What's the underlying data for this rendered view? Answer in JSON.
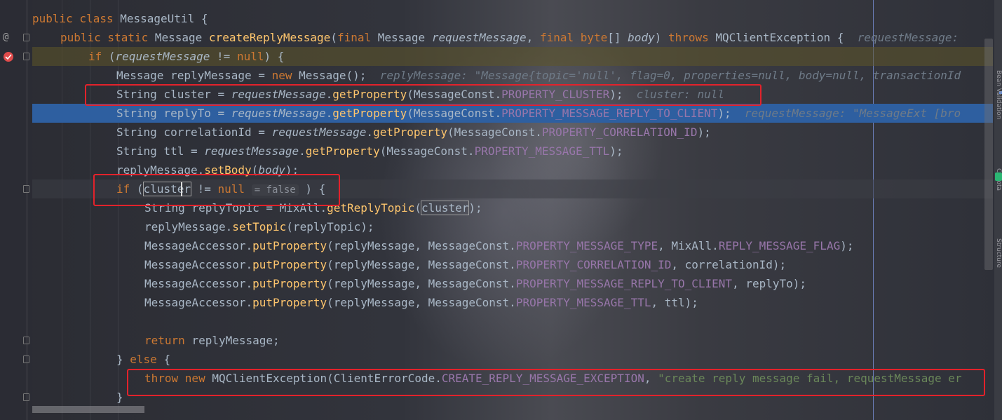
{
  "editor": {
    "file_class": "MessageUtil",
    "lines": [
      [
        [
          "public class ",
          "kw"
        ],
        [
          "MessageUtil ",
          ""
        ],
        [
          "{",
          ""
        ]
      ],
      [
        [
          "public static ",
          "kw"
        ],
        [
          "Message ",
          ""
        ],
        [
          "createReplyMessage",
          "fn"
        ],
        [
          "(",
          ""
        ],
        [
          "final ",
          "kw"
        ],
        [
          "Message ",
          ""
        ],
        [
          "requestMessage",
          "it"
        ],
        [
          ", ",
          ""
        ],
        [
          "final byte",
          "kw"
        ],
        [
          "[] ",
          ""
        ],
        [
          "body",
          "it"
        ],
        [
          ") ",
          ""
        ],
        [
          "throws ",
          "kw"
        ],
        [
          "MQClientException ",
          ""
        ],
        [
          "{ ",
          ""
        ],
        [
          " requestMessage: ",
          "inl"
        ]
      ],
      [
        [
          "if ",
          "kw"
        ],
        [
          "(",
          ""
        ],
        [
          "requestMessage",
          "it"
        ],
        [
          " != ",
          ""
        ],
        [
          "null",
          "kw"
        ],
        [
          ") {",
          ""
        ]
      ],
      [
        [
          "Message replyMessage = ",
          ""
        ],
        [
          "new ",
          "kw"
        ],
        [
          "Message",
          ""
        ],
        [
          "(",
          ""
        ],
        [
          ")",
          ""
        ],
        [
          "; ",
          ""
        ],
        [
          " replyMessage: \"Message{topic='null', flag=0, properties=null, body=null, transactionId",
          "inl"
        ]
      ],
      [
        [
          "String cluster = ",
          ""
        ],
        [
          "requestMessage",
          "it"
        ],
        [
          ".",
          ""
        ],
        [
          "getProperty",
          "fn"
        ],
        [
          "(MessageConst.",
          ""
        ],
        [
          "PROPERTY_CLUSTER",
          "cn"
        ],
        [
          ");",
          ""
        ],
        [
          "  cluster: null",
          "inl"
        ]
      ],
      [
        [
          "String replyTo = ",
          ""
        ],
        [
          "requestMessage",
          "it"
        ],
        [
          ".",
          ""
        ],
        [
          "getProperty",
          "fn"
        ],
        [
          "(MessageConst.",
          ""
        ],
        [
          "PROPERTY_MESSAGE_REPLY_TO_CLIENT",
          "cn"
        ],
        [
          ");",
          ""
        ],
        [
          "  requestMessage: \"MessageExt [bro",
          "inl"
        ]
      ],
      [
        [
          "String correlationId = ",
          ""
        ],
        [
          "requestMessage",
          "it"
        ],
        [
          ".",
          ""
        ],
        [
          "getProperty",
          "fn"
        ],
        [
          "(MessageConst.",
          ""
        ],
        [
          "PROPERTY_CORRELATION_ID",
          "cn"
        ],
        [
          ");",
          ""
        ]
      ],
      [
        [
          "String ttl = ",
          ""
        ],
        [
          "requestMessage",
          "it"
        ],
        [
          ".",
          ""
        ],
        [
          "getProperty",
          "fn"
        ],
        [
          "(MessageConst.",
          ""
        ],
        [
          "PROPERTY_MESSAGE_TTL",
          "cn"
        ],
        [
          ");",
          ""
        ]
      ],
      [
        [
          "replyMessage.",
          ""
        ],
        [
          "setBody",
          "fn"
        ],
        [
          "(",
          ""
        ],
        [
          "body",
          "it"
        ],
        [
          ");",
          ""
        ]
      ],
      [
        [
          "if ",
          "kw"
        ],
        [
          "(",
          ""
        ],
        [
          "cluster",
          "boxed"
        ],
        [
          " != ",
          ""
        ],
        [
          "null",
          "kw"
        ],
        [
          " ",
          ""
        ],
        [
          "= false",
          "inlhint"
        ],
        [
          " ) {",
          ""
        ]
      ],
      [
        [
          "String replyTopic = MixAll.",
          ""
        ],
        [
          "getReplyTopic",
          "fn"
        ],
        [
          "(",
          ""
        ],
        [
          "cluster",
          "boxed"
        ],
        [
          ");",
          ""
        ]
      ],
      [
        [
          "replyMessage.",
          ""
        ],
        [
          "setTopic",
          "fn"
        ],
        [
          "(replyTopic);",
          ""
        ]
      ],
      [
        [
          "MessageAccessor.",
          ""
        ],
        [
          "putProperty",
          "fn"
        ],
        [
          "(replyMessage, MessageConst.",
          ""
        ],
        [
          "PROPERTY_MESSAGE_TYPE",
          "cn"
        ],
        [
          ", MixAll.",
          ""
        ],
        [
          "REPLY_MESSAGE_FLAG",
          "cn"
        ],
        [
          ");",
          ""
        ]
      ],
      [
        [
          "MessageAccessor.",
          ""
        ],
        [
          "putProperty",
          "fn"
        ],
        [
          "(replyMessage, MessageConst.",
          ""
        ],
        [
          "PROPERTY_CORRELATION_ID",
          "cn"
        ],
        [
          ", correlationId);",
          ""
        ]
      ],
      [
        [
          "MessageAccessor.",
          ""
        ],
        [
          "putProperty",
          "fn"
        ],
        [
          "(replyMessage, MessageConst.",
          ""
        ],
        [
          "PROPERTY_MESSAGE_REPLY_TO_CLIENT",
          "cn"
        ],
        [
          ", replyTo);",
          ""
        ]
      ],
      [
        [
          "MessageAccessor.",
          ""
        ],
        [
          "putProperty",
          "fn"
        ],
        [
          "(replyMessage, MessageConst.",
          ""
        ],
        [
          "PROPERTY_MESSAGE_TTL",
          "cn"
        ],
        [
          ", ttl);",
          ""
        ]
      ],
      [],
      [
        [
          "return ",
          "kw"
        ],
        [
          "replyMessage;",
          ""
        ]
      ],
      [
        [
          "} ",
          ""
        ],
        [
          "else ",
          "kw"
        ],
        [
          "{",
          ""
        ]
      ],
      [
        [
          "throw new ",
          "kw"
        ],
        [
          "MQClientException(ClientErrorCode.",
          ""
        ],
        [
          "CREATE_REPLY_MESSAGE_EXCEPTION",
          "cn"
        ],
        [
          ", ",
          ""
        ],
        [
          "\"create reply message fail, requestMessage er",
          "str"
        ]
      ],
      [
        [
          "}",
          ""
        ]
      ]
    ]
  },
  "gutter": {
    "override_symbol": "@"
  },
  "colors": {
    "keyword": "#cc7832",
    "method": "#ffc66d",
    "constant": "#9876aa",
    "string": "#6a8759",
    "text": "#a9b7c6",
    "breakpoint": "#e04b4b",
    "execution_line": "#2e5fa0",
    "annotation_box": "#e3222b"
  },
  "side_panel": {
    "labels": [
      "Bean Validation",
      "Codota",
      "Structure"
    ]
  }
}
